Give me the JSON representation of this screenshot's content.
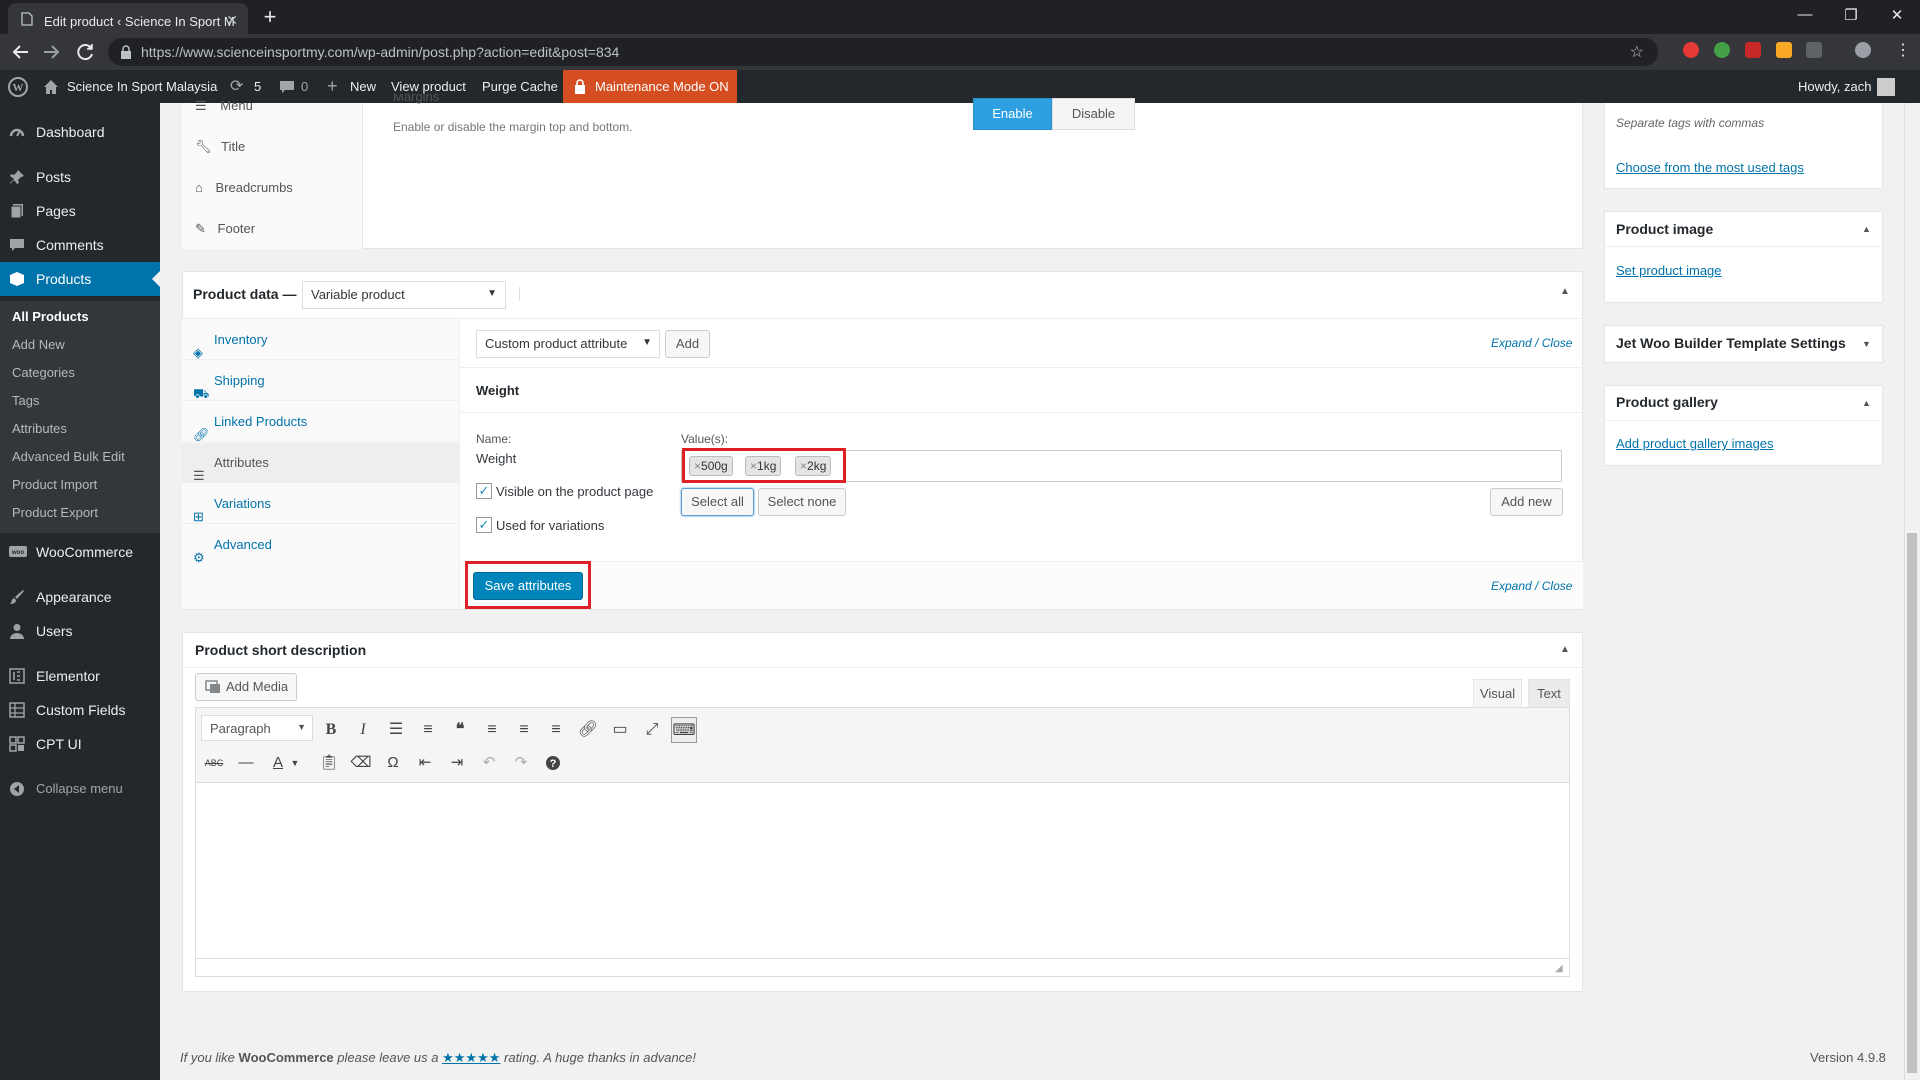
{
  "browser": {
    "tab_title": "Edit product ‹ Science In Sport M",
    "url": "https://www.scienceinsportmy.com/wp-admin/post.php?action=edit&post=834"
  },
  "adminbar": {
    "site_name": "Science In Sport Malaysia",
    "updates_count": "5",
    "comments_count": "0",
    "new_label": "New",
    "view_product": "View product",
    "purge_cache": "Purge Cache",
    "maintenance": "Maintenance Mode ON",
    "howdy": "Howdy, zach"
  },
  "sidebar": {
    "items": [
      {
        "label": "Dashboard",
        "icon": "dashboard-icon"
      },
      {
        "label": "Posts",
        "icon": "pin-icon"
      },
      {
        "label": "Pages",
        "icon": "pages-icon"
      },
      {
        "label": "Comments",
        "icon": "comment-icon"
      },
      {
        "label": "Products",
        "icon": "box-icon"
      },
      {
        "label": "WooCommerce",
        "icon": "woo-icon"
      },
      {
        "label": "Appearance",
        "icon": "brush-icon"
      },
      {
        "label": "Users",
        "icon": "user-icon"
      },
      {
        "label": "Elementor",
        "icon": "elementor-icon"
      },
      {
        "label": "Custom Fields",
        "icon": "fields-icon"
      },
      {
        "label": "CPT UI",
        "icon": "cpt-icon"
      }
    ],
    "products_sub": [
      "All Products",
      "Add New",
      "Categories",
      "Tags",
      "Attributes",
      "Advanced Bulk Edit",
      "Product Import",
      "Product Export"
    ],
    "collapse": "Collapse menu"
  },
  "top_panel": {
    "menu_items": [
      "Menu",
      "Title",
      "Breadcrumbs",
      "Footer"
    ],
    "margins_label": "Margins",
    "margins_desc": "Enable or disable the margin top and bottom.",
    "enable": "Enable",
    "disable": "Disable"
  },
  "product_data": {
    "heading": "Product data —",
    "type_selected": "Variable product",
    "tabs": [
      "Inventory",
      "Shipping",
      "Linked Products",
      "Attributes",
      "Variations",
      "Advanced"
    ],
    "attr_select": "Custom product attribute",
    "add": "Add",
    "expand": "Expand",
    "slash": "/",
    "close": "Close",
    "attribute_title": "Weight",
    "name_label": "Name:",
    "name_value": "Weight",
    "values_label": "Value(s):",
    "values": [
      "500g",
      "1kg",
      "2kg"
    ],
    "visible_label": "Visible on the product page",
    "used_label": "Used for variations",
    "select_all": "Select all",
    "select_none": "Select none",
    "add_new": "Add new",
    "save_attributes": "Save attributes"
  },
  "short_desc": {
    "heading": "Product short description",
    "add_media": "Add Media",
    "visual": "Visual",
    "text": "Text",
    "paragraph": "Paragraph"
  },
  "right_sidebar": {
    "tags_hint": "Separate tags with commas",
    "tags_link": "Choose from the most used tags",
    "product_image": "Product image",
    "set_image": "Set product image",
    "jet": "Jet Woo Builder Template Settings",
    "gallery": "Product gallery",
    "add_gallery": "Add product gallery images"
  },
  "footer": {
    "text_before": "If you like",
    "woo": "WooCommerce",
    "text_mid": "please leave us a",
    "stars": "★★★★★",
    "text_after": "rating. A huge thanks in advance!",
    "version": "Version 4.9.8"
  },
  "colors": {
    "accent": "#0073aa",
    "admin_bar": "#23282d",
    "maintenance": "#d54e21",
    "highlight": "#dd1f26"
  }
}
